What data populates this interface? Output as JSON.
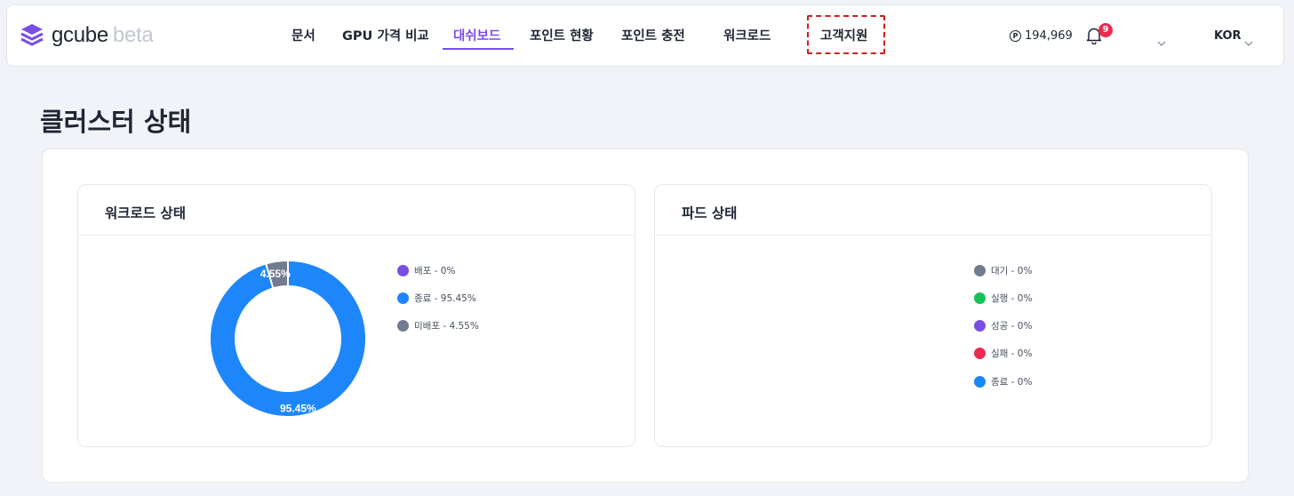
{
  "header": {
    "logo": {
      "name": "gcube",
      "suffix": "beta",
      "icon": "layered-cube-icon",
      "color": "#7b4ee6"
    },
    "nav": [
      {
        "label": "문서"
      },
      {
        "label": "GPU 가격 비교"
      },
      {
        "label": "대쉬보드",
        "active": true
      },
      {
        "label": "포인트 현황"
      },
      {
        "label": "포인트 충전"
      },
      {
        "label": "워크로드"
      },
      {
        "label": "고객지원",
        "highlighted": true
      }
    ],
    "points": {
      "icon": "P",
      "value": "194,969"
    },
    "notifications": {
      "icon": "bell-icon",
      "count": "9"
    },
    "language": "KOR"
  },
  "page_title": "클러스터 상태",
  "workload_card": {
    "title": "워크로드 상태",
    "chart_data": {
      "type": "pie",
      "style": "donut",
      "slices": [
        {
          "label": "배포",
          "value": 0,
          "color": "#7b4ee6"
        },
        {
          "label": "종료",
          "value": 95.45,
          "color": "#1e86fb"
        },
        {
          "label": "미배포",
          "value": 4.55,
          "color": "#737b91"
        }
      ],
      "legend": [
        {
          "text": "배포 - 0%",
          "color": "#7b4ee6"
        },
        {
          "text": "종료 - 95.45%",
          "color": "#1e86fb"
        },
        {
          "text": "미배포 - 4.55%",
          "color": "#737b91"
        }
      ],
      "data_labels": [
        "4.55%",
        "95.45%"
      ]
    }
  },
  "pod_card": {
    "title": "파드 상태",
    "legend": [
      {
        "text": "대기 - 0%",
        "color": "#737b91"
      },
      {
        "text": "실행 - 0%",
        "color": "#16c258"
      },
      {
        "text": "성공 - 0%",
        "color": "#7b4ee6"
      },
      {
        "text": "실패 - 0%",
        "color": "#ea2c4f"
      },
      {
        "text": "종료 - 0%",
        "color": "#1e86fb"
      }
    ]
  }
}
